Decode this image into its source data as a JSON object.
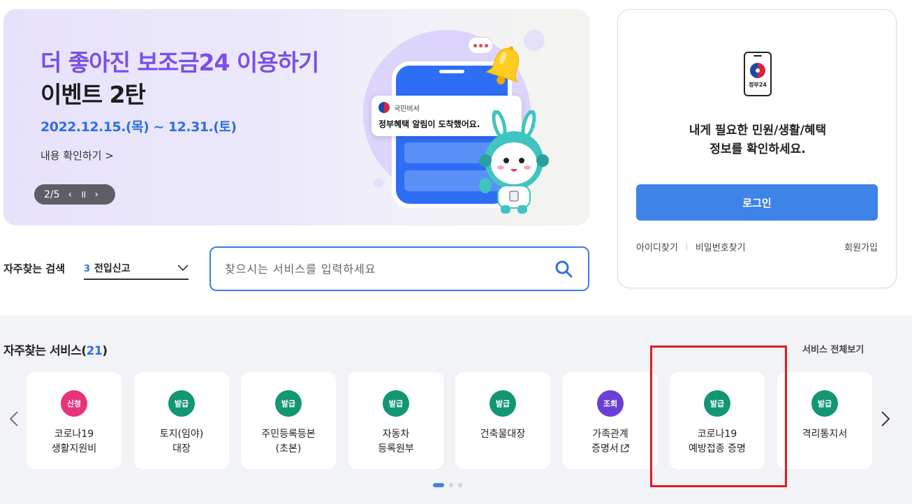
{
  "banner": {
    "title_line1": "더 좋아진 보조금24 이용하기",
    "title_line2": "이벤트 2탄",
    "date": "2022.12.15.(목) ~ 12.31.(토)",
    "link": "내용 확인하기 >",
    "pager": "2/5",
    "prev_icon": "‹",
    "pause_icon": "॥",
    "next_icon": "›",
    "notification": {
      "sender": "국민비서",
      "message": "정부혜택 알림이 도착했어요."
    }
  },
  "search": {
    "fav_label": "자주찾는 검색",
    "fav_number": "3",
    "fav_value": "전입신고",
    "placeholder": "찾으시는 서비스를 입력하세요"
  },
  "login": {
    "logo_text": "정부24",
    "message_line1": "내게 필요한 민원/생활/혜택",
    "message_line2": "정보를 확인하세요.",
    "button": "로그인",
    "find_id": "아이디찾기",
    "find_pw": "비밀번호찾기",
    "signup": "회원가입"
  },
  "services": {
    "title": "자주찾는 서비스(",
    "count": "21",
    "title_end": ")",
    "view_all": "서비스 전체보기",
    "items": [
      {
        "badge": "신청",
        "color": "#e8327c",
        "name": "코로나19\n생활지원비"
      },
      {
        "badge": "발급",
        "color": "#139672",
        "name": "토지(임야)\n대장"
      },
      {
        "badge": "발급",
        "color": "#139672",
        "name": "주민등록등본\n(초본)"
      },
      {
        "badge": "발급",
        "color": "#139672",
        "name": "자동차\n등록원부"
      },
      {
        "badge": "발급",
        "color": "#139672",
        "name": "건축물대장"
      },
      {
        "badge": "조회",
        "color": "#6a3fd6",
        "name": "가족관계\n증명서"
      },
      {
        "badge": "발급",
        "color": "#139672",
        "name": "코로나19\n예방접종 증명"
      },
      {
        "badge": "발급",
        "color": "#139672",
        "name": "격리통지서"
      }
    ]
  }
}
